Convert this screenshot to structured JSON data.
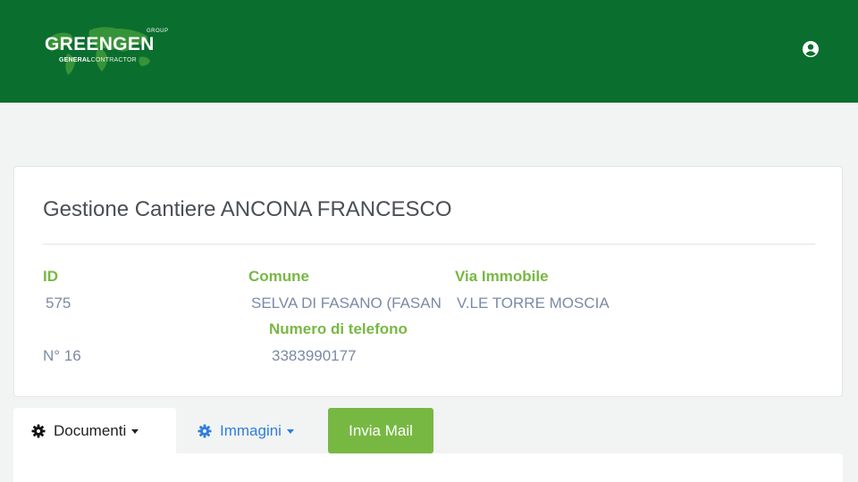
{
  "header": {
    "logo": {
      "group": "GROUP",
      "main": "GREENGEN",
      "sub_bold": "GENERAL",
      "sub_rest": "CONTRACTOR"
    },
    "user_icon": "user-circle-icon",
    "background_color": "#0a6e2e"
  },
  "site": {
    "title": "Gestione Cantiere ANCONA FRANCESCO",
    "fields": {
      "id_label": "ID",
      "id_value": "575",
      "comune_label": "Comune",
      "comune_value": "SELVA DI FASANO (FASAN",
      "via_label": "Via Immobile",
      "via_value": "V.LE TORRE MOSCIA",
      "telefono_label": "Numero di telefono",
      "telefono_value": "3383990177",
      "civico_value": "N° 16"
    },
    "label_color": "#78b843",
    "value_color": "#7b8aa5"
  },
  "tabs": {
    "documenti": {
      "label": "Documenti",
      "icon": "gear-icon",
      "active": true
    },
    "immagini": {
      "label": "Immagini",
      "icon": "gear-icon",
      "color": "#2f7de1"
    },
    "invia_mail": {
      "label": "Invia Mail",
      "color": "#77b843"
    }
  }
}
